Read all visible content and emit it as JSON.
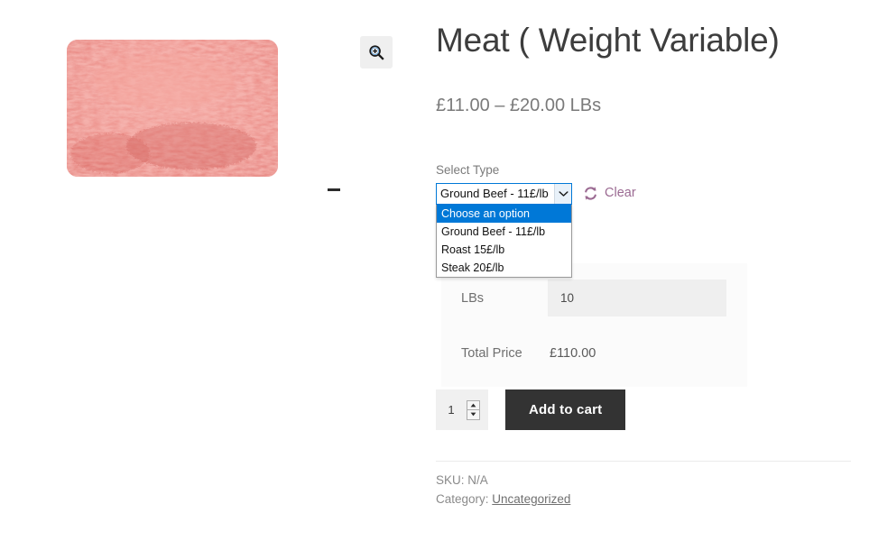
{
  "product": {
    "title": "Meat ( Weight Variable)",
    "price_range": "£11.00 – £20.00 LBs",
    "image_alt": "ground-beef-photo",
    "zoom_icon": "magnifier-plus-icon"
  },
  "variations": {
    "attribute_label": "Select Type",
    "selected_option": "Ground Beef - 11£/lb",
    "dropdown_open": true,
    "options": [
      "Choose an option",
      "Ground Beef - 11£/lb",
      "Roast 15£/lb",
      "Steak 20£/lb"
    ],
    "highlighted_option": "Choose an option",
    "clear": {
      "label": "Clear",
      "icon": "refresh-icon",
      "color": "#9b6a92"
    },
    "arrow_icon": "chevron-down-icon"
  },
  "calculator": {
    "rows": [
      {
        "label": "LBs",
        "value": "10",
        "type": "input"
      },
      {
        "label": "Total Price",
        "value": "£110.00",
        "type": "text"
      }
    ]
  },
  "cart": {
    "quantity": "1",
    "quantity_min": "1",
    "add_to_cart_label": "Add to cart",
    "button_color": "#333333",
    "spinner_up_icon": "caret-up-icon",
    "spinner_down_icon": "caret-down-icon"
  },
  "meta": {
    "sku_label": "SKU:",
    "sku_value": "N/A",
    "category_label": "Category:",
    "category_value": "Uncategorized"
  },
  "colors": {
    "focus_blue": "#0078d7",
    "page_background": "#ffffff",
    "table_background": "#fbfbfb",
    "input_background": "#efefef"
  }
}
